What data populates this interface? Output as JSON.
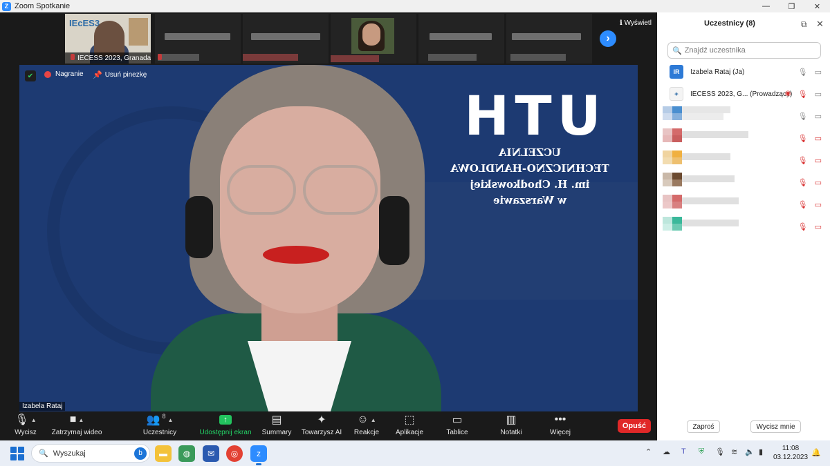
{
  "window": {
    "title": "Zoom Spotkanie",
    "controls": [
      "—",
      "❐",
      "✕"
    ]
  },
  "strip": {
    "thumbs": [
      {
        "label": "IECESS 2023, Granada..."
      }
    ],
    "view_label": "Wyświetl",
    "next_arrow": "›"
  },
  "video": {
    "recording_label": "Nagranie",
    "unpin_label": "Usuń pinezkę",
    "speaker_name": "Izabela Rataj",
    "background_logo": "UTH",
    "background_lines": [
      "UCZELNIA",
      "TECHNICZNO-HANDLOWA",
      "im. H. Chodkowskiej",
      "w Warszawie"
    ]
  },
  "toolbar": {
    "buttons": [
      {
        "label": "Wycisz",
        "icon": "microphone-icon"
      },
      {
        "label": "Zatrzymaj wideo",
        "icon": "video-camera-icon"
      },
      {
        "label": "Uczestnicy",
        "icon": "participants-icon",
        "count": "8"
      },
      {
        "label": "Udostępnij ekran",
        "icon": "share-screen-icon"
      },
      {
        "label": "Summary",
        "icon": "summary-icon"
      },
      {
        "label": "Towarzysz AI",
        "icon": "ai-sparkle-icon"
      },
      {
        "label": "Reakcje",
        "icon": "reaction-icon"
      },
      {
        "label": "Aplikacje",
        "icon": "apps-icon"
      },
      {
        "label": "Tablice",
        "icon": "whiteboard-icon"
      },
      {
        "label": "Notatki",
        "icon": "notes-icon"
      },
      {
        "label": "Więcej",
        "icon": "more-icon"
      }
    ],
    "leave_label": "Opuść"
  },
  "panel": {
    "title": "Uczestnicy (8)",
    "search_placeholder": "Znajdź uczestnika",
    "participants": [
      {
        "initials": "IR",
        "name": "Izabela Rataj (Ja)",
        "avatar_color": "#2d7ad6"
      },
      {
        "initials": "",
        "name": "IECESS 2023, G...  (Prowadzący)",
        "avatar_color": "#ffffff"
      }
    ],
    "invite_label": "Zaproś",
    "mute_me_label": "Wycisz mnie"
  },
  "taskbar": {
    "search_label": "Wyszukaj",
    "time": "11:08",
    "date": "03.12.2023"
  },
  "colors": {
    "zoom_blue": "#2d8cff",
    "share_green": "#22c35e",
    "leave_red": "#e02828",
    "muted_red": "#d93030"
  }
}
